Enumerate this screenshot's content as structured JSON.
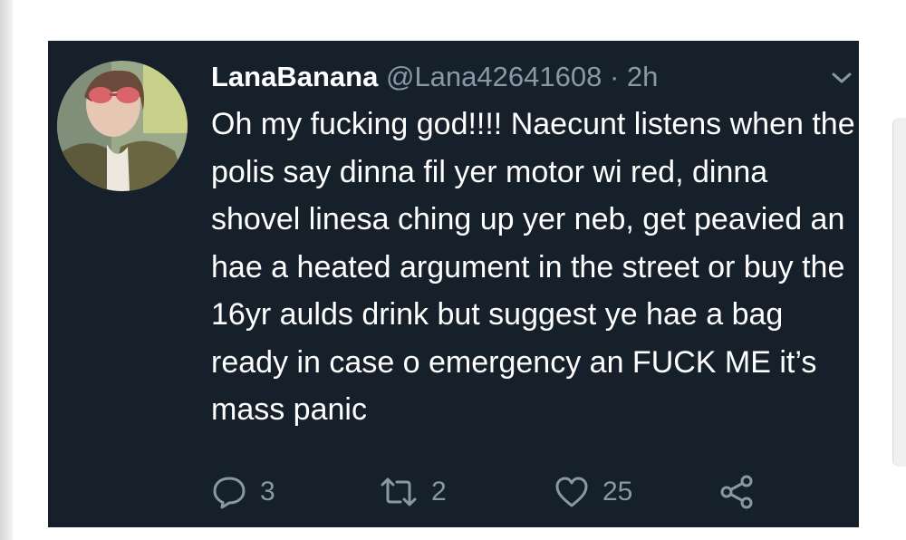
{
  "tweet": {
    "display_name": "LanaBanana",
    "handle": "@Lana42641608",
    "separator": "·",
    "time": "2h",
    "text": "Oh my fucking god!!!! Naecunt listens when the polis say dinna fil yer motor wi red, dinna shovel linesa ching up yer neb, get peavied an hae a heated argument in the street or buy the 16yr aulds drink but suggest ye hae a bag ready in case o emergency an FUCK ME it’s mass panic"
  },
  "actions": {
    "reply": {
      "icon": "reply-icon",
      "count": "3"
    },
    "retweet": {
      "icon": "retweet-icon",
      "count": "2"
    },
    "like": {
      "icon": "heart-icon",
      "count": "25"
    },
    "share": {
      "icon": "share-icon"
    }
  },
  "colors": {
    "background": "#15202b",
    "text": "#ffffff",
    "muted": "#8899a6"
  }
}
